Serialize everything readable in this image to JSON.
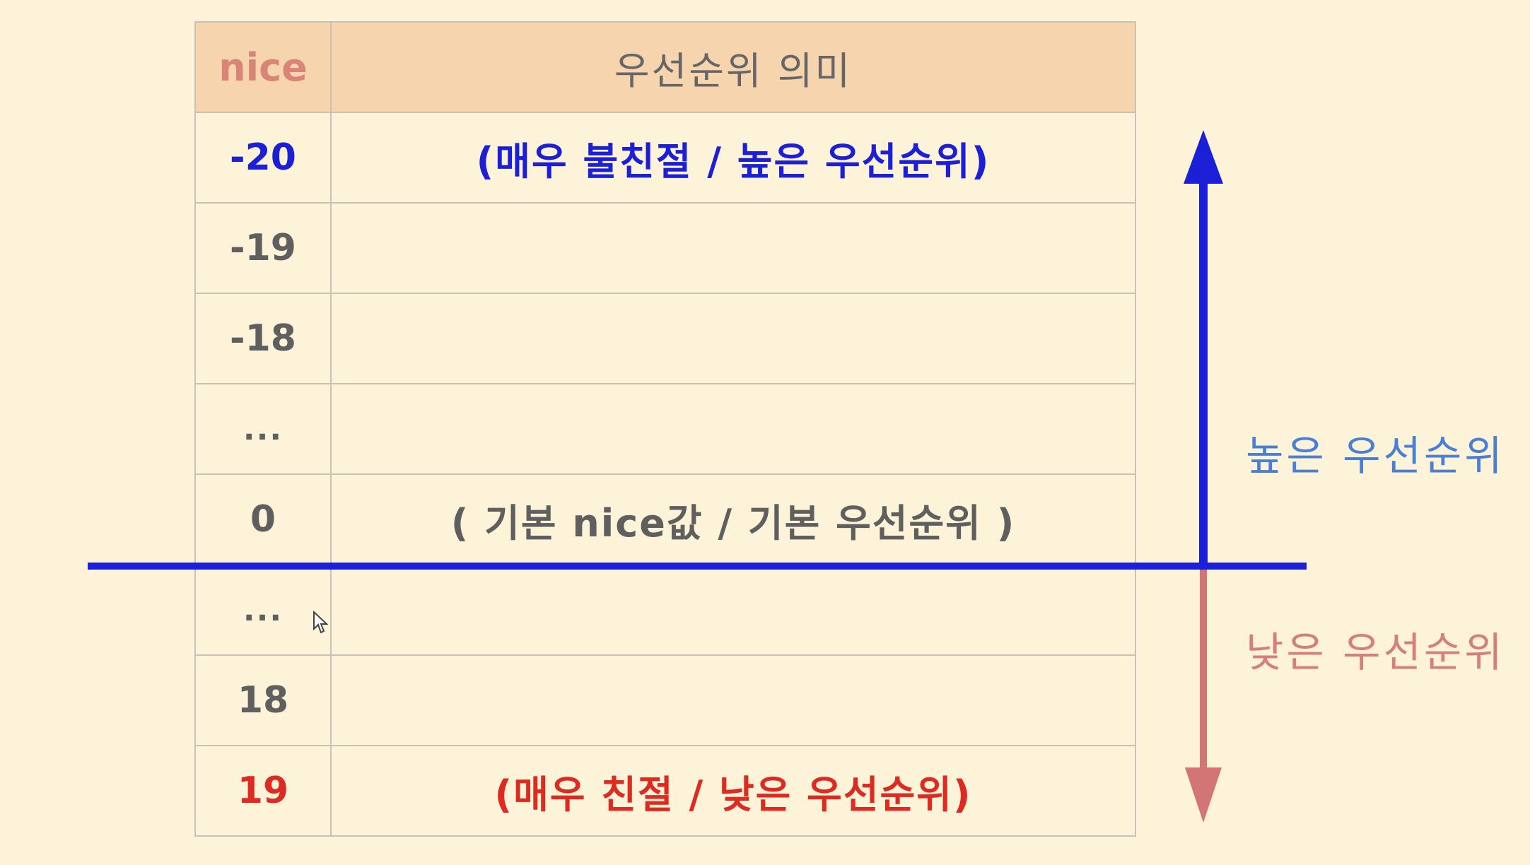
{
  "table": {
    "headers": {
      "nice": "nice",
      "meaning": "우선순위 의미"
    },
    "rows": [
      {
        "nice": "-20",
        "meaning": "(매우 불친절 / 높은 우선순위)"
      },
      {
        "nice": "-19",
        "meaning": ""
      },
      {
        "nice": "-18",
        "meaning": ""
      },
      {
        "nice": "...",
        "meaning": ""
      },
      {
        "nice": "0",
        "meaning": "( 기본 nice값 /  기본 우선순위 )"
      },
      {
        "nice": "...",
        "meaning": ""
      },
      {
        "nice": "18",
        "meaning": ""
      },
      {
        "nice": "19",
        "meaning": "(매우 친절 / 낮은 우선순위)"
      }
    ]
  },
  "labels": {
    "high": "높은 우선순위",
    "low": "낮은 우선순위"
  },
  "colors": {
    "background": "#fdf3d9",
    "header": "#f6d4ae",
    "blue": "#1b1fd6",
    "red": "#dd2b22",
    "high_label": "#4a7fd6",
    "low_label": "#d47e7e"
  },
  "icons": {
    "up_arrow": "arrow-up-icon",
    "down_arrow": "arrow-down-icon",
    "cursor": "mouse-cursor-icon"
  }
}
